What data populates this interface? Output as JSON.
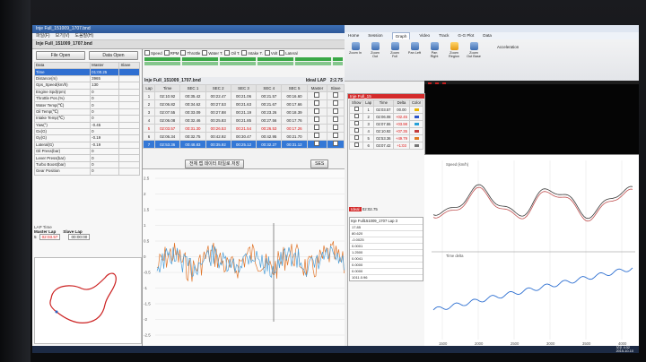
{
  "left_app": {
    "title": "Inje Full_151009_1707.bnd",
    "menu": [
      "파일(F)",
      "보기(V)",
      "도움말(H)"
    ],
    "file_title": "Inje Full_151009_1707.bnd",
    "file_open_label": "File Open",
    "data_open_label": "Data Open",
    "channel_headers": [
      "Data",
      "Master",
      "Slave"
    ],
    "channels": [
      {
        "name": "Time",
        "master": "01:00.25",
        "slave": ""
      },
      {
        "name": "Distance(m)",
        "master": "3965",
        "slave": ""
      },
      {
        "name": "Gps_Speed(km/h)",
        "master": "130",
        "slave": ""
      },
      {
        "name": "Engine Spd(rpm)",
        "master": "0",
        "slave": ""
      },
      {
        "name": "Throttle Pos.(%)",
        "master": "0",
        "slave": ""
      },
      {
        "name": "Water Temp(℃)",
        "master": "0",
        "slave": ""
      },
      {
        "name": "Oil Temp(℃)",
        "master": "0",
        "slave": ""
      },
      {
        "name": "Intake Temp(℃)",
        "master": "0",
        "slave": ""
      },
      {
        "name": "Yaw(°)",
        "master": "-0.45",
        "slave": ""
      },
      {
        "name": "Gx(G)",
        "master": "0",
        "slave": ""
      },
      {
        "name": "Gy(G)",
        "master": "-0.19",
        "slave": ""
      },
      {
        "name": "Lateral(G)",
        "master": "-0.19",
        "slave": ""
      },
      {
        "name": "Oil Press(bar)",
        "master": "0",
        "slave": ""
      },
      {
        "name": "Lever Press(bar)",
        "master": "0",
        "slave": ""
      },
      {
        "name": "Turbo Boost(bar)",
        "master": "0",
        "slave": ""
      },
      {
        "name": "Gear Position",
        "master": "0",
        "slave": ""
      }
    ],
    "lap_time_label": "LAP Time",
    "master_lap_label": "Master Lap",
    "slave_lap_label": "Slave Lap",
    "master_lap_no": "5",
    "master_lap_time": "02:03.57",
    "slave_lap_time": "00:00:00",
    "toolbar_checks": [
      "Speed",
      "RPM",
      "Throttle",
      "Water T.",
      "Oil T.",
      "Intake T.",
      "Volt",
      "Lateral"
    ],
    "lap_header": "Inje Full_151009_1707.bnd",
    "ideal_lap_label": "Ideal LAP",
    "ideal_lap_value": "2:2.75",
    "lap_columns": [
      "Lap",
      "Time",
      "SEC 1",
      "SEC 2",
      "SEC 3",
      "SEC 4",
      "SEC 5",
      "Master",
      "Slave"
    ],
    "laps": [
      {
        "lap": "1",
        "time": "02:10.92",
        "s1": "00:35.42",
        "s2": "00:22.47",
        "s3": "00:21.06",
        "s4": "00:21.57",
        "s5": "00:16.60",
        "red": false
      },
      {
        "lap": "2",
        "time": "02:06.82",
        "s1": "00:34.62",
        "s2": "00:27.53",
        "s3": "00:21.63",
        "s4": "00:21.67",
        "s5": "00:17.66",
        "red": false
      },
      {
        "lap": "3",
        "time": "02:07.55",
        "s1": "00:33.09",
        "s2": "00:27.88",
        "s3": "00:21.19",
        "s4": "00:23.26",
        "s5": "00:18.39",
        "red": false
      },
      {
        "lap": "4",
        "time": "02:06.08",
        "s1": "00:32.46",
        "s2": "00:25.83",
        "s3": "00:21.85",
        "s4": "00:27.56",
        "s5": "00:17.76",
        "red": false
      },
      {
        "lap": "5",
        "time": "02:03.57",
        "s1": "00:31.30",
        "s2": "00:26.53",
        "s3": "00:21.54",
        "s4": "00:26.53",
        "s5": "00:17.26",
        "red": true
      },
      {
        "lap": "6",
        "time": "02:06.34",
        "s1": "00:32.75",
        "s2": "00:42.92",
        "s3": "00:30.47",
        "s4": "00:42.95",
        "s5": "00:21.70",
        "red": false
      },
      {
        "lap": "7",
        "time": "02:53.36",
        "s1": "00:48.83",
        "s2": "00:35.92",
        "s3": "00:25.12",
        "s4": "00:32.27",
        "s5": "00:31.12",
        "red": false,
        "selected": true
      }
    ],
    "bottom_buttons": [
      "전체 랩 데이터 파일로 저장",
      "SES"
    ],
    "graph_xticks": [
      "502.00",
      "1002.00",
      "1502.00",
      "2002.00"
    ],
    "graph_yticks": [
      "-2.5",
      "-2",
      "-1.5",
      "-1",
      "-0.5",
      "0",
      "0.5",
      "1",
      "1.5",
      "2",
      "2.5"
    ]
  },
  "right_app": {
    "title": "",
    "tabs": [
      "Home",
      "Session",
      "Graph",
      "Video",
      "Track",
      "G-G Plot",
      "Data"
    ],
    "active_tab": "Graph",
    "ribbon_buttons": [
      "Zoom In",
      "Zoom Out",
      "Zoom Full",
      "Pan Left",
      "Pan Right",
      "Zoom Region",
      "Zoom Out Base"
    ],
    "accelerator_label": "Acceleration",
    "session_title": "Inje Full_15",
    "session_columns": [
      "Show",
      "Lap",
      "Time",
      "Delta",
      "Color"
    ],
    "session_rows": [
      {
        "lap": "1",
        "time": "02:03.57",
        "delta": "00.00"
      },
      {
        "lap": "2",
        "time": "02:06.08",
        "delta": "+02.45"
      },
      {
        "lap": "3",
        "time": "02:07.55",
        "delta": "+03.98"
      },
      {
        "lap": "4",
        "time": "02:10.92",
        "delta": "+07.35"
      },
      {
        "lap": "5",
        "time": "02:53.36",
        "delta": "+49.79"
      },
      {
        "lap": "6",
        "time": "03:07.42",
        "delta": "+1:03"
      }
    ],
    "ideal_label": "Ideal",
    "ideal_value": "02:02.75",
    "info_title": "Inje Full151009_1707 Lap 3",
    "info_rows": [
      "17.85",
      "80.620",
      "-0.0025",
      "0.0001",
      "1.2500",
      "0.0041",
      "0.0000",
      "0.0000",
      "1011.0.96"
    ],
    "graph_top_label": "Speed (km/h)",
    "graph_bottom_label": "Time delta",
    "graph_xticks": [
      "1500",
      "2000",
      "2500",
      "3000",
      "3500",
      "4000"
    ],
    "time_label": "오후 4:32",
    "date_label": "2015-10-10"
  }
}
